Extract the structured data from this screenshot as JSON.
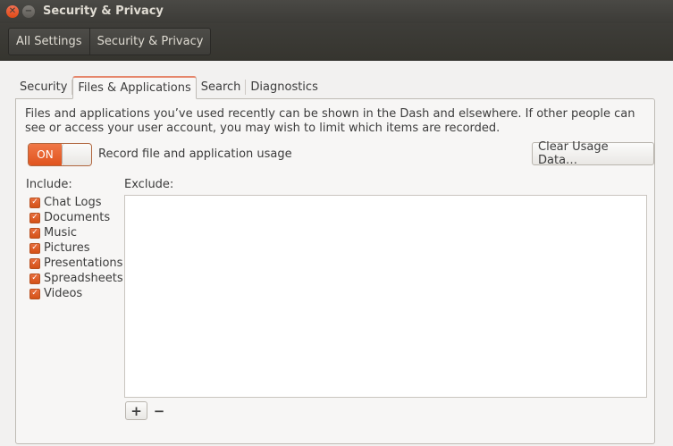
{
  "window": {
    "title": "Security & Privacy"
  },
  "breadcrumb": [
    "All Settings",
    "Security & Privacy"
  ],
  "tabs": [
    {
      "label": "Security",
      "active": false
    },
    {
      "label": "Files & Applications",
      "active": true
    },
    {
      "label": "Search",
      "active": false
    },
    {
      "label": "Diagnostics",
      "active": false
    }
  ],
  "files": {
    "description": "Files and applications you’ve used recently can be shown in the Dash and elsewhere. If other people can see or access your user account, you may wish to limit which items are recorded.",
    "toggle_state": "ON",
    "toggle_label": "Record file and application usage",
    "clear_button": "Clear Usage Data…",
    "include_label": "Include:",
    "exclude_label": "Exclude:",
    "include_items": [
      {
        "label": "Chat Logs",
        "checked": true
      },
      {
        "label": "Documents",
        "checked": true
      },
      {
        "label": "Music",
        "checked": true
      },
      {
        "label": "Pictures",
        "checked": true
      },
      {
        "label": "Presentations",
        "checked": true
      },
      {
        "label": "Spreadsheets",
        "checked": true
      },
      {
        "label": "Videos",
        "checked": true
      }
    ],
    "add_symbol": "+",
    "remove_symbol": "−"
  },
  "colors": {
    "accent": "#e0541f",
    "titlebar": "#3c3b37",
    "background": "#f2f1f0"
  },
  "icons": {
    "close": "close-icon",
    "minimize": "minimize-icon",
    "check": "checkmark-icon"
  }
}
